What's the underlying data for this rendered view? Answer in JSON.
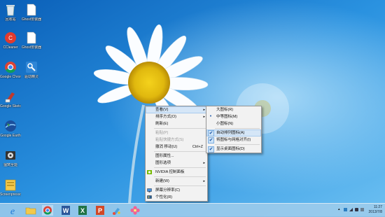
{
  "desktop": {
    "icons": [
      {
        "label": "回收站",
        "icon": "recycle-bin-icon"
      },
      {
        "label": "Ghost安装器",
        "icon": "file-icon"
      },
      {
        "label": "CCleaner",
        "icon": "ccleaner-icon"
      },
      {
        "label": "Ghost安装器",
        "icon": "file-icon"
      },
      {
        "label": "Google Chrome",
        "icon": "chrome-icon"
      },
      {
        "label": "驱动精灵",
        "icon": "driver-icon"
      },
      {
        "label": "Google SketchUp 8",
        "icon": "sketchup-icon"
      },
      {
        "label": "Google Earth",
        "icon": "earth-icon"
      },
      {
        "label": "狸窝全能",
        "icon": "video-converter-icon"
      },
      {
        "label": "Screenpresso",
        "icon": "screenpresso-icon"
      }
    ]
  },
  "context_menu": {
    "items": [
      {
        "label": "查看(V)",
        "arrow": true,
        "highlight": true
      },
      {
        "label": "排序方式(O)",
        "arrow": true
      },
      {
        "label": "刷新(E)"
      },
      {
        "sep": true
      },
      {
        "label": "粘贴(P)",
        "disabled": true
      },
      {
        "label": "粘贴快捷方式(S)",
        "disabled": true
      },
      {
        "label": "撤消 移动(U)",
        "accel": "Ctrl+Z"
      },
      {
        "sep": true
      },
      {
        "label": "图形属性..."
      },
      {
        "label": "图形选项",
        "arrow": true
      },
      {
        "sep": true
      },
      {
        "label": "NVIDIA 控制面板",
        "icon": "nvidia-icon"
      },
      {
        "sep": true
      },
      {
        "label": "新建(W)",
        "arrow": true
      },
      {
        "sep": true
      },
      {
        "label": "屏幕分辨率(C)",
        "icon": "display-icon"
      },
      {
        "label": "个性化(R)",
        "icon": "personalize-icon"
      }
    ]
  },
  "view_submenu": {
    "items": [
      {
        "label": "大图标(R)"
      },
      {
        "label": "中等图标(M)",
        "radio": true
      },
      {
        "label": "小图标(N)"
      },
      {
        "sep": true
      },
      {
        "label": "自动排列图标(A)",
        "checked": true,
        "highlight": true
      },
      {
        "label": "将图标与网格对齐(I)",
        "checked": true
      },
      {
        "sep": true
      },
      {
        "label": "显示桌面图标(D)",
        "checked": true
      }
    ]
  },
  "taskbar": {
    "apps": [
      "ie-icon",
      "explorer-icon",
      "chrome-icon",
      "word-icon",
      "excel-icon",
      "powerpoint-icon",
      "paint-icon",
      "flower-icon"
    ],
    "clock": {
      "time": "11:27",
      "date": "2013/7/8"
    }
  }
}
